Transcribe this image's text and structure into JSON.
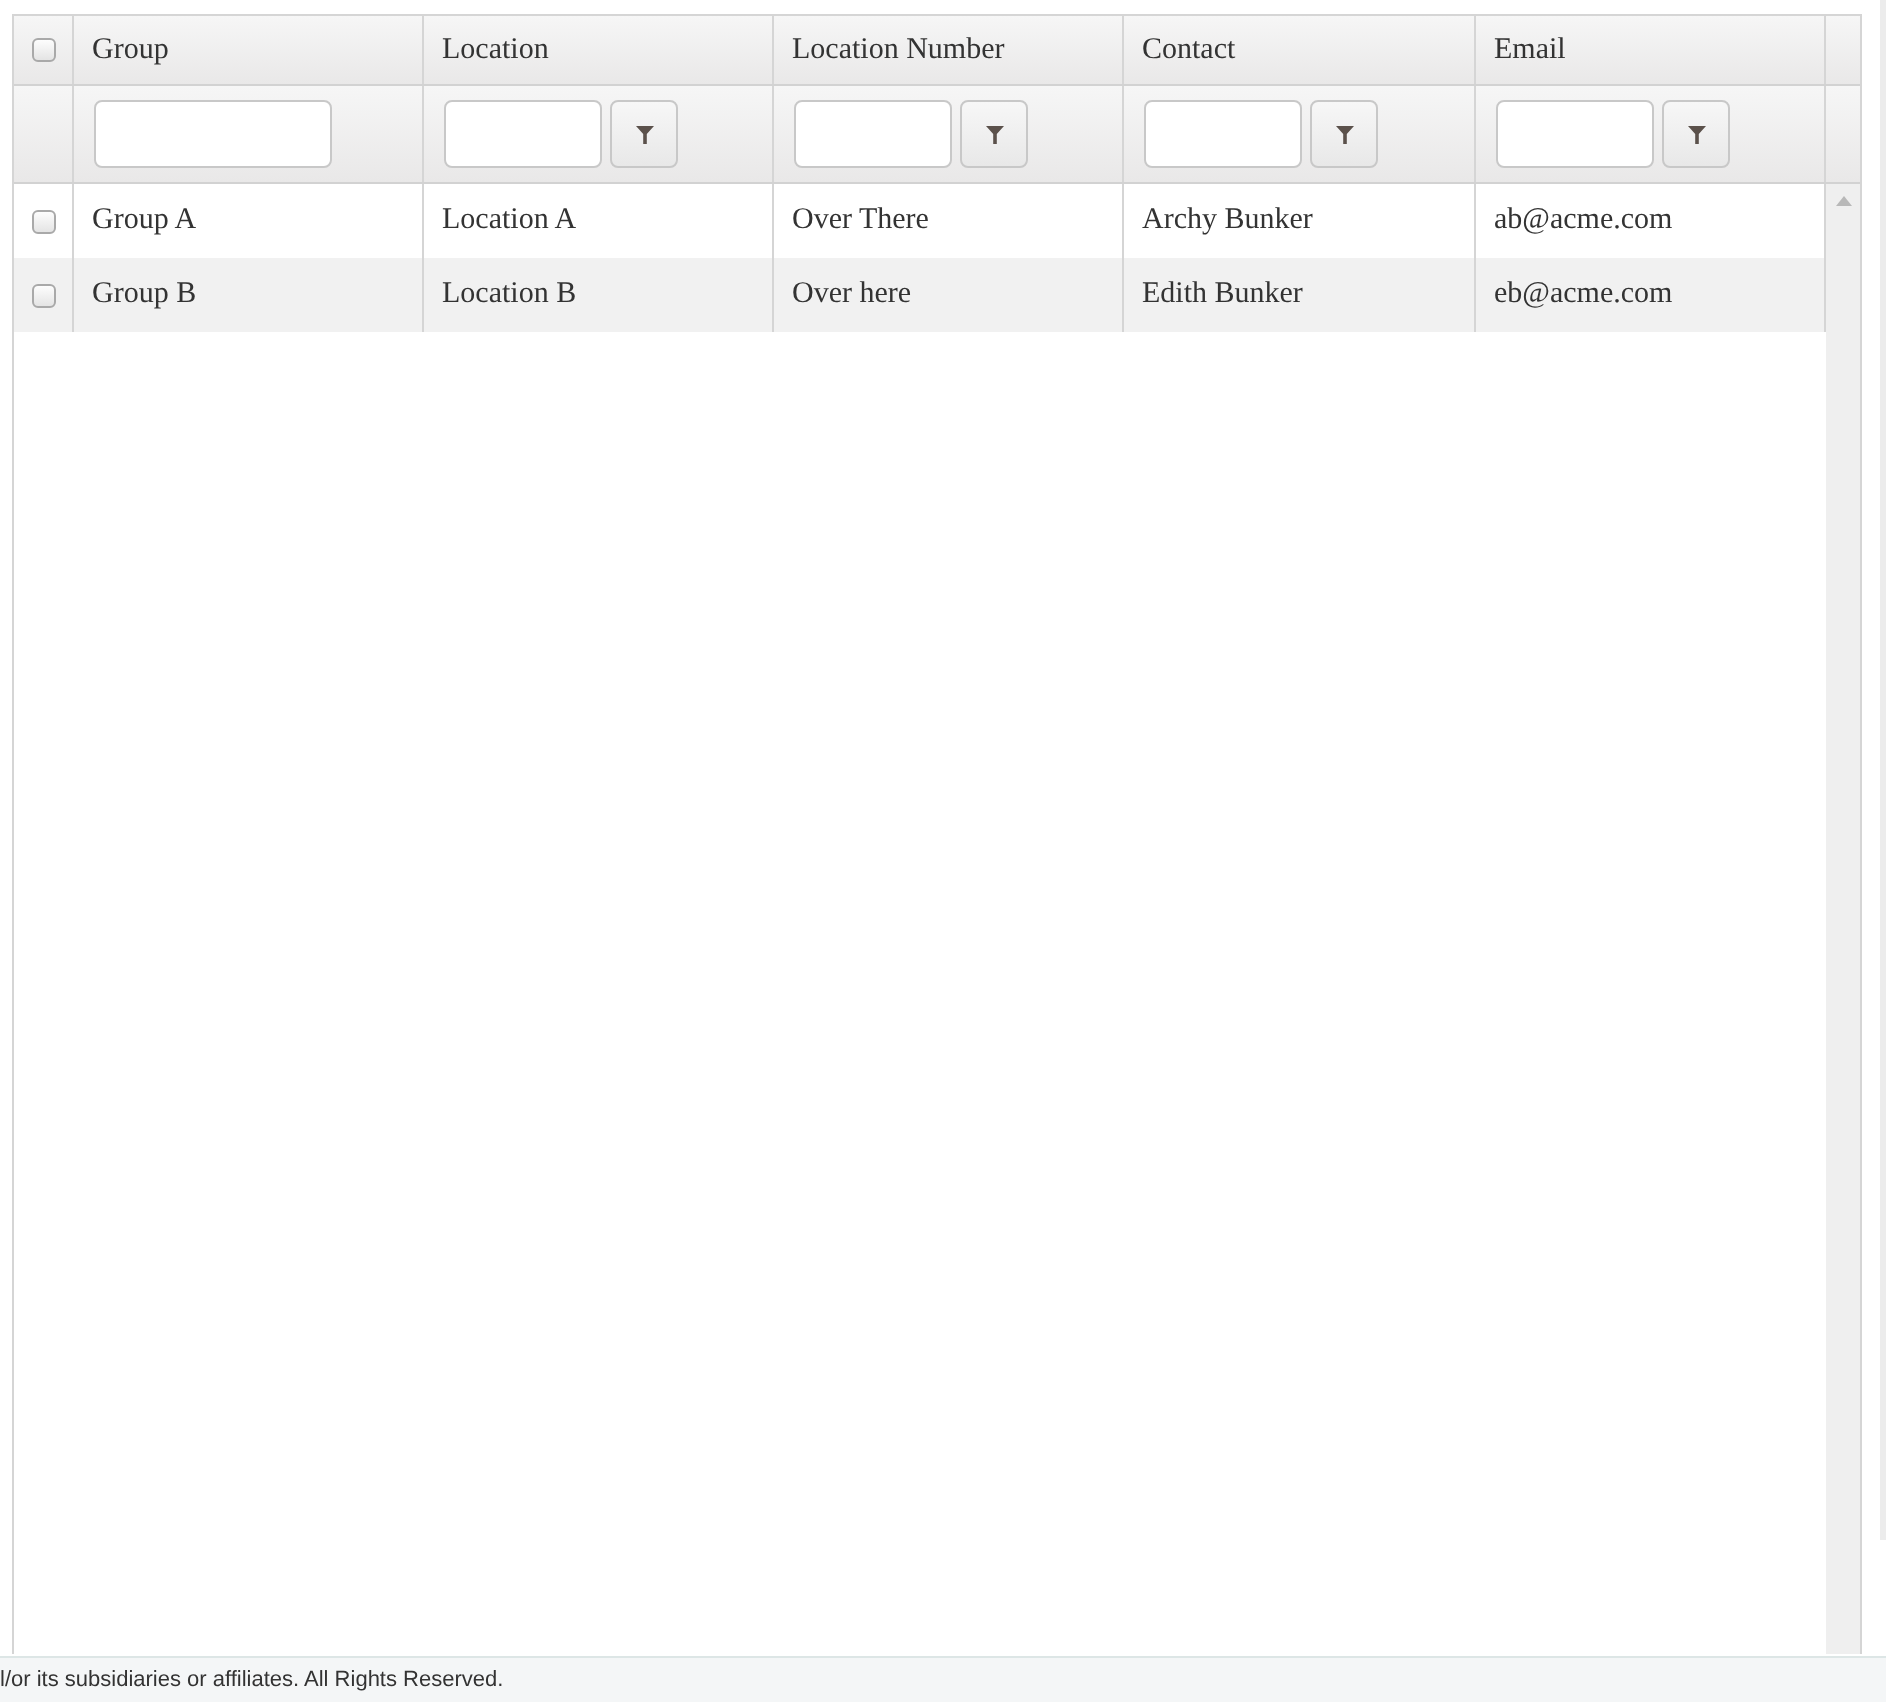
{
  "table": {
    "select_all": {
      "checked": false
    },
    "columns": [
      {
        "label": "Group",
        "filter_button": false
      },
      {
        "label": "Location",
        "filter_button": true
      },
      {
        "label": "Location Number",
        "filter_button": true
      },
      {
        "label": "Contact",
        "filter_button": true
      },
      {
        "label": "Email",
        "filter_button": true
      }
    ],
    "rows": [
      {
        "selected": false,
        "cells": [
          "Group A",
          "Location A",
          "Over There",
          "Archy Bunker",
          "ab@acme.com"
        ]
      },
      {
        "selected": false,
        "cells": [
          "Group B",
          "Location B",
          "Over here",
          "Edith Bunker",
          "eb@acme.com"
        ]
      }
    ]
  },
  "footer": {
    "text": "l/or its subsidiaries or affiliates. All Rights Reserved."
  }
}
